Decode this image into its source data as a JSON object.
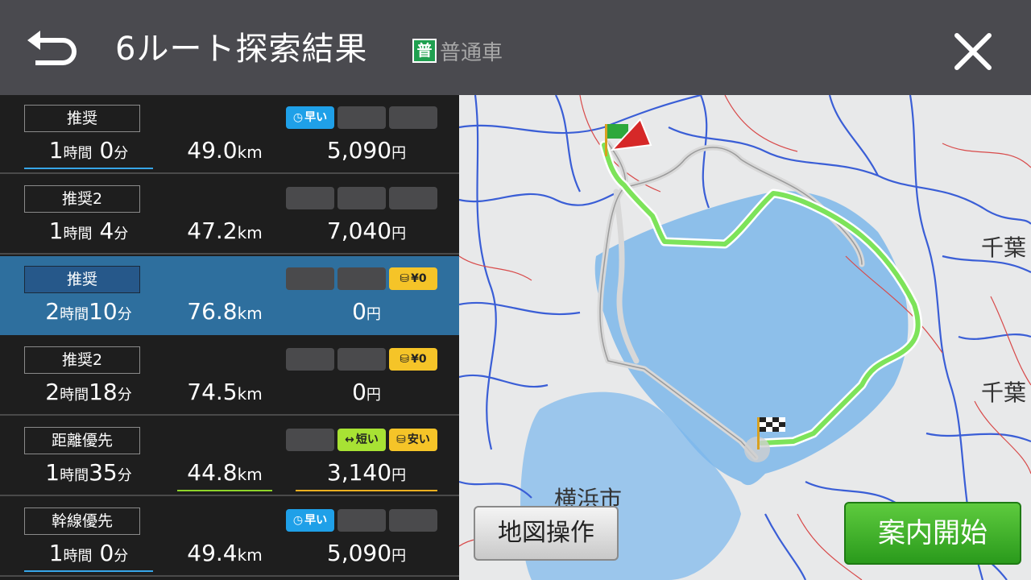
{
  "header": {
    "title": "6ルート探索結果",
    "vehicle_badge": "普",
    "vehicle_label": "普通車"
  },
  "routes": [
    {
      "name": "推奨",
      "hours": "1",
      "h_unit": "時間",
      "minutes": " 0",
      "m_unit": "分",
      "distance": "49.0",
      "d_unit": "km",
      "price": "5,090",
      "p_unit": "円",
      "badges": [
        {
          "type": "fast",
          "text": "早い"
        },
        {
          "type": "empty",
          "text": ""
        },
        {
          "type": "empty",
          "text": ""
        }
      ]
    },
    {
      "name": "推奨2",
      "hours": "1",
      "h_unit": "時間",
      "minutes": " 4",
      "m_unit": "分",
      "distance": "47.2",
      "d_unit": "km",
      "price": "7,040",
      "p_unit": "円",
      "badges": [
        {
          "type": "empty",
          "text": ""
        },
        {
          "type": "empty",
          "text": ""
        },
        {
          "type": "empty",
          "text": ""
        }
      ]
    },
    {
      "name": "推奨",
      "hours": "2",
      "h_unit": "時間",
      "minutes": "10",
      "m_unit": "分",
      "distance": "76.8",
      "d_unit": "km",
      "price": "0",
      "p_unit": "円",
      "badges": [
        {
          "type": "empty",
          "text": ""
        },
        {
          "type": "empty",
          "text": ""
        },
        {
          "type": "cheap",
          "text": "¥0"
        }
      ]
    },
    {
      "name": "推奨2",
      "hours": "2",
      "h_unit": "時間",
      "minutes": "18",
      "m_unit": "分",
      "distance": "74.5",
      "d_unit": "km",
      "price": "0",
      "p_unit": "円",
      "badges": [
        {
          "type": "empty",
          "text": ""
        },
        {
          "type": "empty",
          "text": ""
        },
        {
          "type": "cheap",
          "text": "¥0"
        }
      ]
    },
    {
      "name": "距離優先",
      "hours": "1",
      "h_unit": "時間",
      "minutes": "35",
      "m_unit": "分",
      "distance": "44.8",
      "d_unit": "km",
      "price": "3,140",
      "p_unit": "円",
      "badges": [
        {
          "type": "empty",
          "text": ""
        },
        {
          "type": "short",
          "text": "短い"
        },
        {
          "type": "cheap",
          "text": "安い"
        }
      ]
    },
    {
      "name": "幹線優先",
      "hours": "1",
      "h_unit": "時間",
      "minutes": " 0",
      "m_unit": "分",
      "distance": "49.4",
      "d_unit": "km",
      "price": "5,090",
      "p_unit": "円",
      "badges": [
        {
          "type": "fast",
          "text": "早い"
        },
        {
          "type": "empty",
          "text": ""
        },
        {
          "type": "empty",
          "text": ""
        }
      ]
    }
  ],
  "map": {
    "labels": {
      "yokohama": "横浜市",
      "chiba1": "千葉",
      "chiba2": "千葉"
    },
    "map_op_button": "地図操作",
    "start_button": "案内開始"
  },
  "colors": {
    "header_bg": "#4a4a4f",
    "selected_row": "#2e6f9e",
    "route_green": "#7de35a",
    "start_green": "#2a9a1c"
  }
}
